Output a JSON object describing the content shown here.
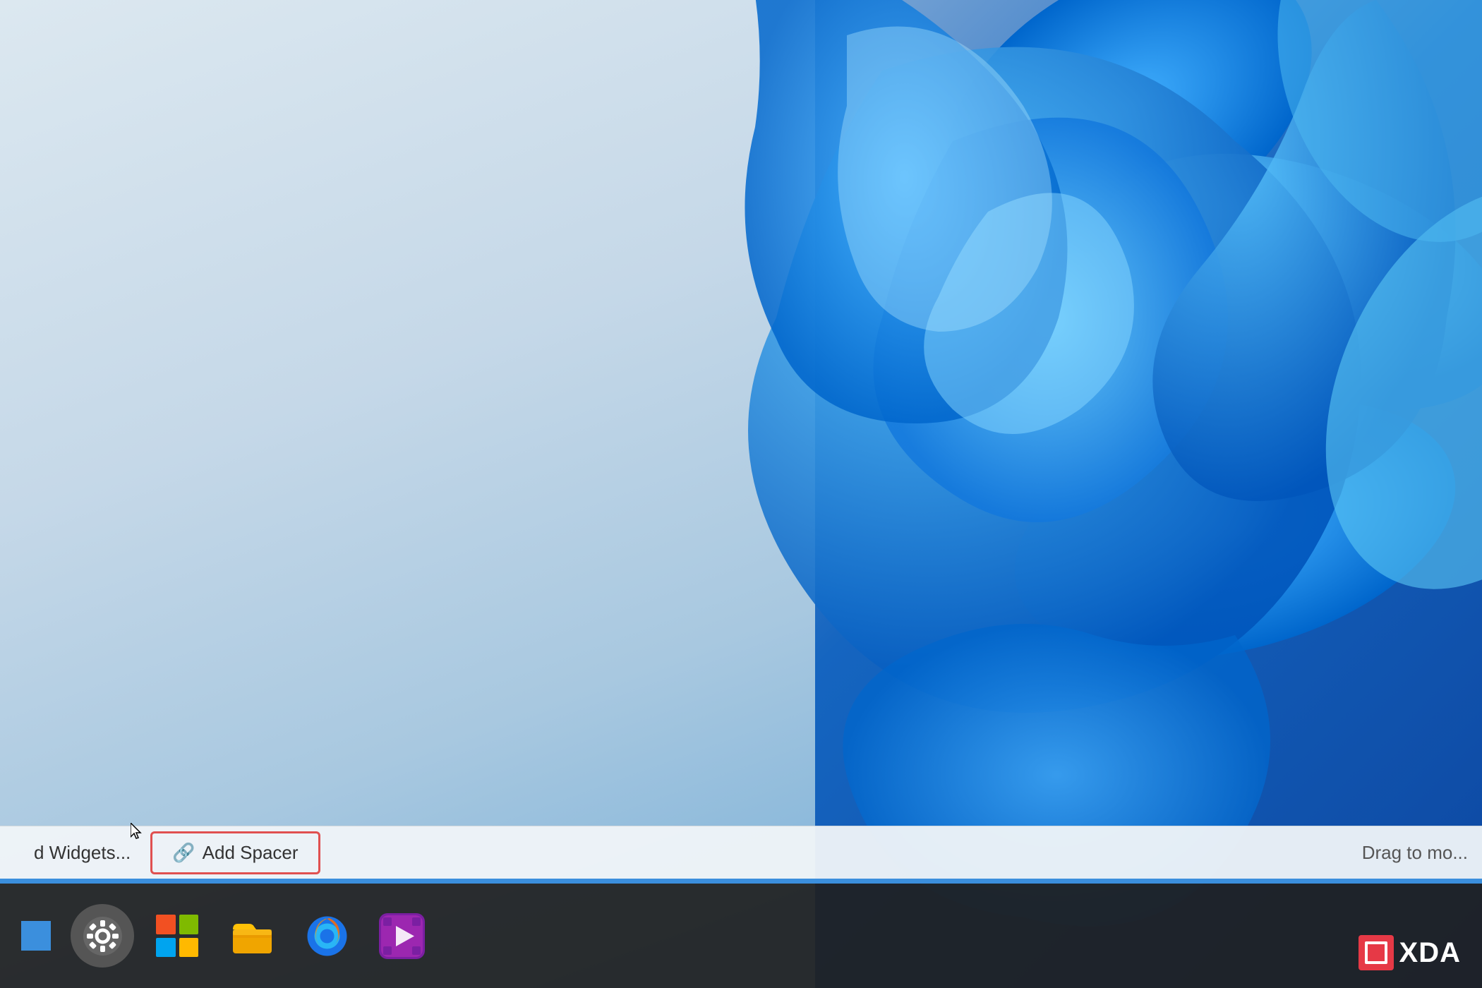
{
  "desktop": {
    "bg_light_color": "#dce8f0",
    "bg_blue_color": "#1565c0"
  },
  "taskbar_context": {
    "add_widgets_label": "d Widgets...",
    "add_spacer_label": "Add Spacer",
    "drag_to_move_label": "Drag to mo...",
    "add_spacer_icon": "🔗",
    "highlight_color": "#e05050"
  },
  "taskbar": {
    "icons": [
      {
        "name": "settings",
        "emoji": "⚙️"
      },
      {
        "name": "windows-colorful",
        "emoji": "🪟"
      },
      {
        "name": "file-explorer",
        "emoji": "📁"
      },
      {
        "name": "firefox",
        "emoji": "🦊"
      },
      {
        "name": "media-player",
        "emoji": "🎬"
      }
    ],
    "bg_color": "rgba(32,32,32,0.92)"
  },
  "xda": {
    "logo_text": "XDA",
    "box_color": "#e63946"
  }
}
